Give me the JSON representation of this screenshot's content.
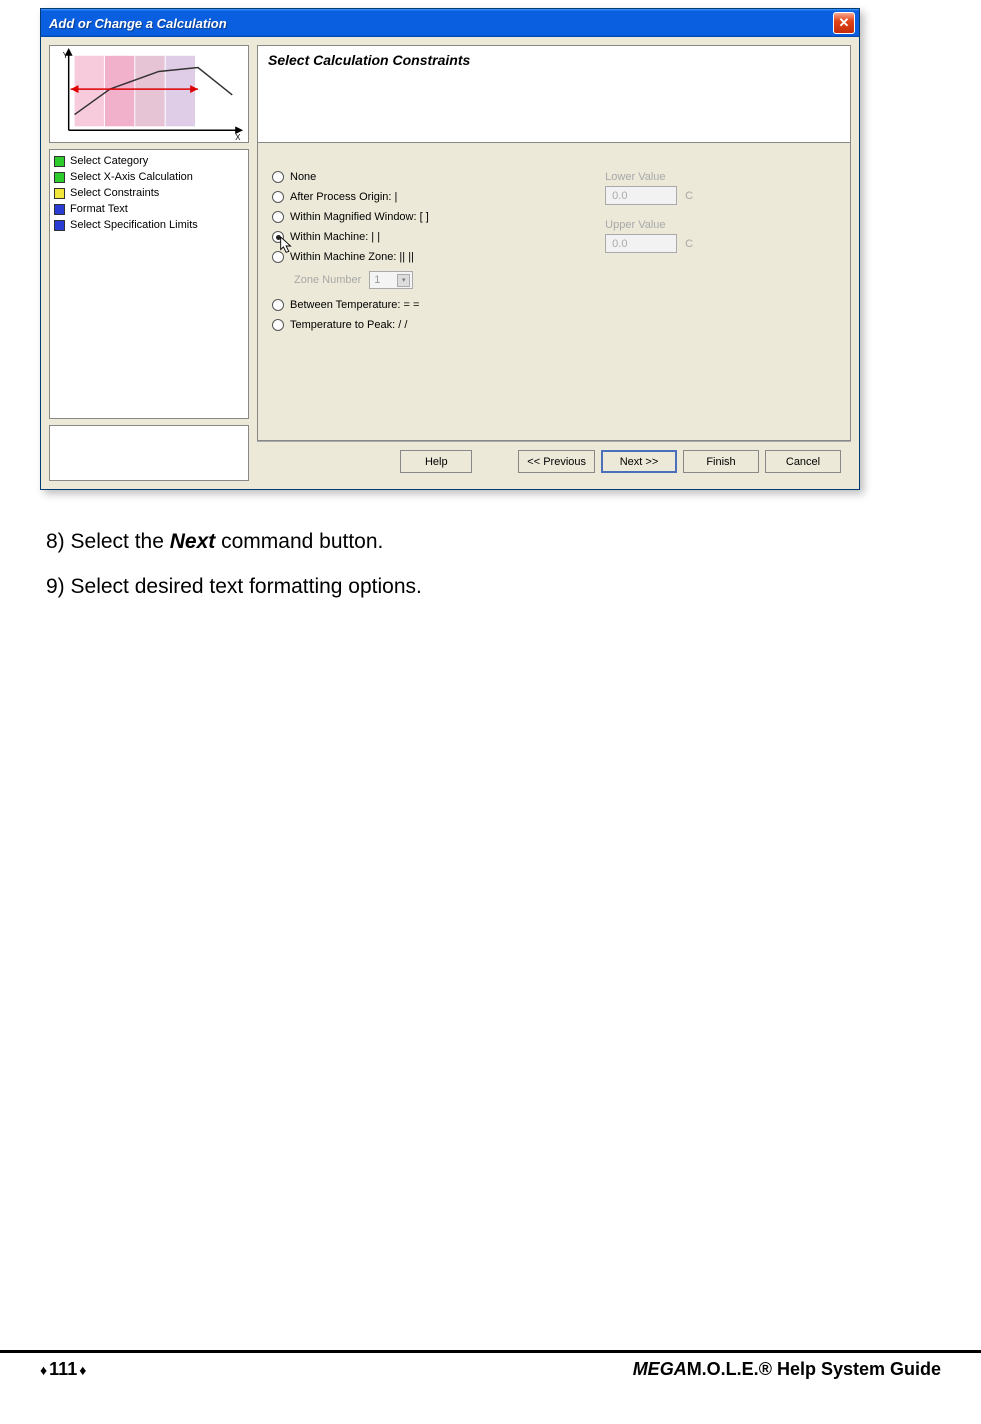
{
  "dialog": {
    "title": "Add or Change a Calculation",
    "heading": "Select Calculation Constraints",
    "steps": [
      {
        "color": "#2ccc2c",
        "label": "Select Category"
      },
      {
        "color": "#2ccc2c",
        "label": "Select X-Axis Calculation"
      },
      {
        "color": "#f2e63a",
        "label": "Select Constraints"
      },
      {
        "color": "#2a3cd4",
        "label": "Format Text"
      },
      {
        "color": "#2a3cd4",
        "label": "Select Specification Limits"
      }
    ],
    "radios": {
      "none": "None",
      "after_process": "After Process Origin: |",
      "within_magnified": "Within Magnified Window: [  ]",
      "within_machine": "Within Machine: |  |",
      "within_machine_zone": "Within Machine Zone: ||  ||",
      "between_temp": "Between Temperature: =  =",
      "temp_to_peak": "Temperature to Peak: /  /"
    },
    "zone": {
      "label": "Zone Number",
      "value": "1"
    },
    "values": {
      "lower_label": "Lower Value",
      "lower_value": "0.0",
      "lower_unit": "C",
      "upper_label": "Upper Value",
      "upper_value": "0.0",
      "upper_unit": "C"
    },
    "buttons": {
      "help": "Help",
      "previous": "<< Previous",
      "next": "Next >>",
      "finish": "Finish",
      "cancel": "Cancel"
    }
  },
  "instructions": {
    "line8_a": "8)  Select the ",
    "line8_b": "Next",
    "line8_c": " command button.",
    "line9": "9)  Select desired text formatting options."
  },
  "footer": {
    "page_number": "111",
    "guide_prefix": "MEGA",
    "guide_suffix": "M.O.L.E.® Help System Guide"
  }
}
